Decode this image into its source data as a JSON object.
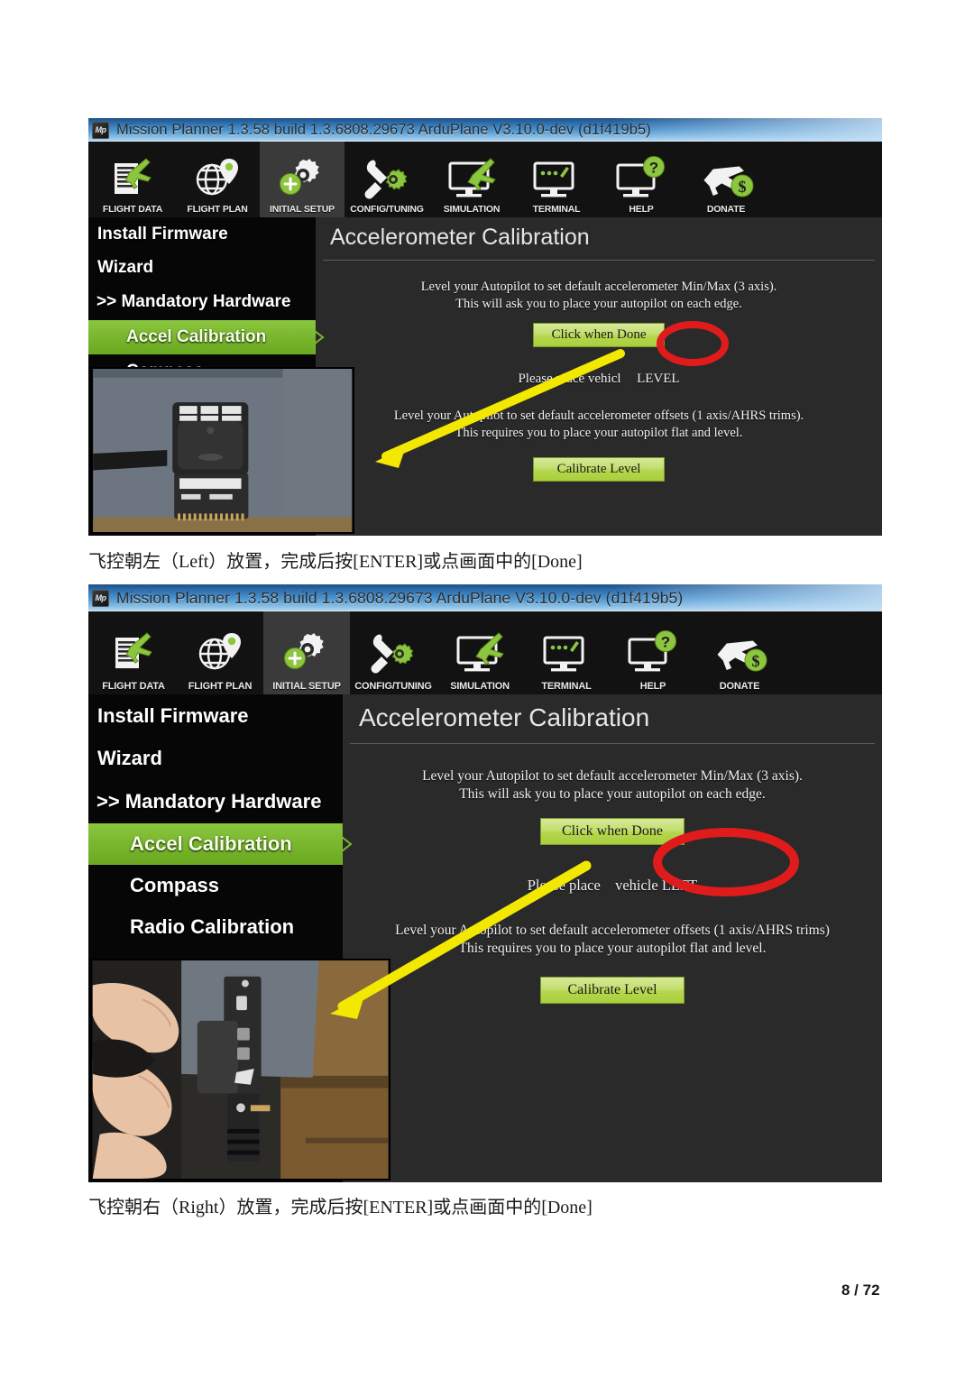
{
  "document": {
    "page_label": "8 / 72",
    "captions": [
      "飞控朝左（Left）放置，完成后按[ENTER]或点画面中的[Done]",
      "飞控朝右（Right）放置，完成后按[ENTER]或点画面中的[Done]"
    ]
  },
  "colors": {
    "accent_green": "#8cc63f",
    "button_green": "#b6d64e",
    "annotation_red": "#e01b1b",
    "annotation_yellow": "#f2e800",
    "title_blue": "#2f6fae",
    "panel_dark": "#2a2a2a",
    "sidebar_black": "#060606"
  },
  "window": {
    "title": "Mission Planner 1.3.58 build 1.3.6808.29673 ArduPlane V3.10.0-dev (d1f419b5)",
    "logo_text": "Mp"
  },
  "toolbar": {
    "items": [
      {
        "label": "FLIGHT DATA",
        "icon": "flight-data-icon",
        "active": false
      },
      {
        "label": "FLIGHT PLAN",
        "icon": "flight-plan-icon",
        "active": false
      },
      {
        "label": "INITIAL SETUP",
        "icon": "initial-setup-icon",
        "active": true
      },
      {
        "label": "CONFIG/TUNING",
        "icon": "config-tuning-icon",
        "active": false
      },
      {
        "label": "SIMULATION",
        "icon": "simulation-icon",
        "active": false
      },
      {
        "label": "TERMINAL",
        "icon": "terminal-icon",
        "active": false
      },
      {
        "label": "HELP",
        "icon": "help-icon",
        "active": false
      },
      {
        "label": "DONATE",
        "icon": "donate-icon",
        "active": false
      }
    ]
  },
  "screenshot_one": {
    "sidebar_items": [
      {
        "label": "Install Firmware",
        "selected": false
      },
      {
        "label": "Wizard",
        "selected": false
      },
      {
        "label": ">> Mandatory Hardware",
        "selected": false
      },
      {
        "label": "Accel Calibration",
        "selected": true
      },
      {
        "label": "Compass",
        "selected": false
      }
    ],
    "panel_title": "Accelerometer Calibration",
    "instruction_block_one": [
      "Level your Autopilot to set default accelerometer Min/Max (3 axis).",
      "This will ask you to place your autopilot on each edge."
    ],
    "button_done": "Click when Done",
    "status_text_prefix": "Please place vehicl",
    "status_text_highlight": "LEVEL",
    "instruction_block_two": [
      "Level your Autopilot to set default accelerometer offsets (1 axis/AHRS trims).",
      "This requires you to place your autopilot flat and level."
    ],
    "button_calibrate": "Calibrate Level",
    "photo_alt": "flight-controller-lying-flat-on-gray-mat"
  },
  "screenshot_two": {
    "sidebar_items": [
      {
        "label": "Install Firmware",
        "selected": false
      },
      {
        "label": "Wizard",
        "selected": false
      },
      {
        "label": ">> Mandatory Hardware",
        "selected": false
      },
      {
        "label": "Accel Calibration",
        "selected": true
      },
      {
        "label": "Compass",
        "selected": false
      },
      {
        "label": "Radio Calibration",
        "selected": false
      }
    ],
    "panel_title": "Accelerometer Calibration",
    "instruction_block_one": [
      "Level your Autopilot to set default accelerometer Min/Max (3 axis).",
      "This will ask you to place your autopilot on each edge."
    ],
    "button_done": "Click when Done",
    "status_text_prefix": "Please place",
    "status_text_highlight": "vehicle LEFT",
    "instruction_block_two": [
      "Level your Autopilot to set default accelerometer offsets (1 axis/AHRS trims)",
      "This requires you to place your autopilot flat and level."
    ],
    "button_calibrate": "Calibrate Level",
    "photo_alt": "hand-holding-flight-controller-on-left-edge"
  }
}
